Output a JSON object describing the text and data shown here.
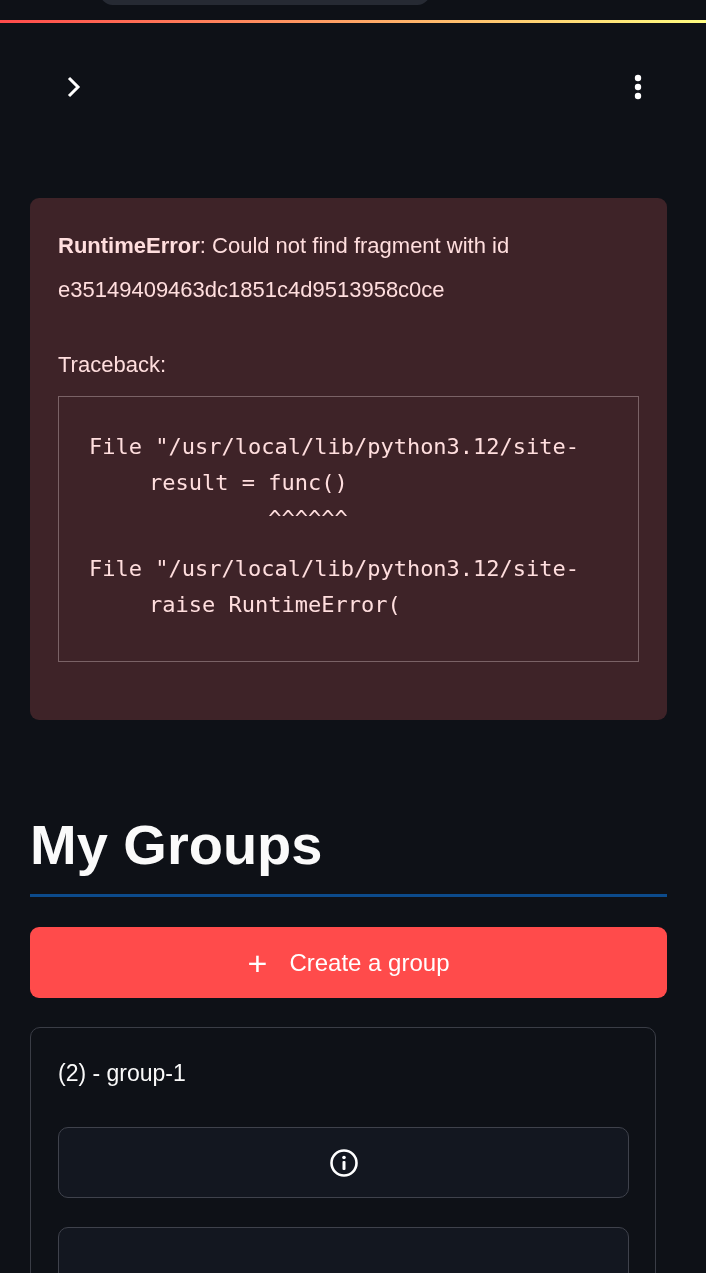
{
  "error": {
    "message": "**RuntimeError**: Could not find fragment with id e35149409463dc1851c4d9513958c0ce",
    "traceback_label": "Traceback:",
    "frames": [
      {
        "file": "File \"/usr/local/lib/python3.12/site-",
        "code": "result = func()",
        "marker": "         ^^^^^^"
      },
      {
        "file": "File \"/usr/local/lib/python3.12/site-",
        "code": "raise RuntimeError("
      }
    ]
  },
  "groups": {
    "heading": "My Groups",
    "create_button": {
      "icon": "+",
      "label": "Create a group"
    },
    "cards": [
      {
        "title": "(2) - group-1",
        "buttons": [
          {
            "kind": "info"
          },
          {
            "kind": "blank"
          }
        ]
      }
    ]
  }
}
